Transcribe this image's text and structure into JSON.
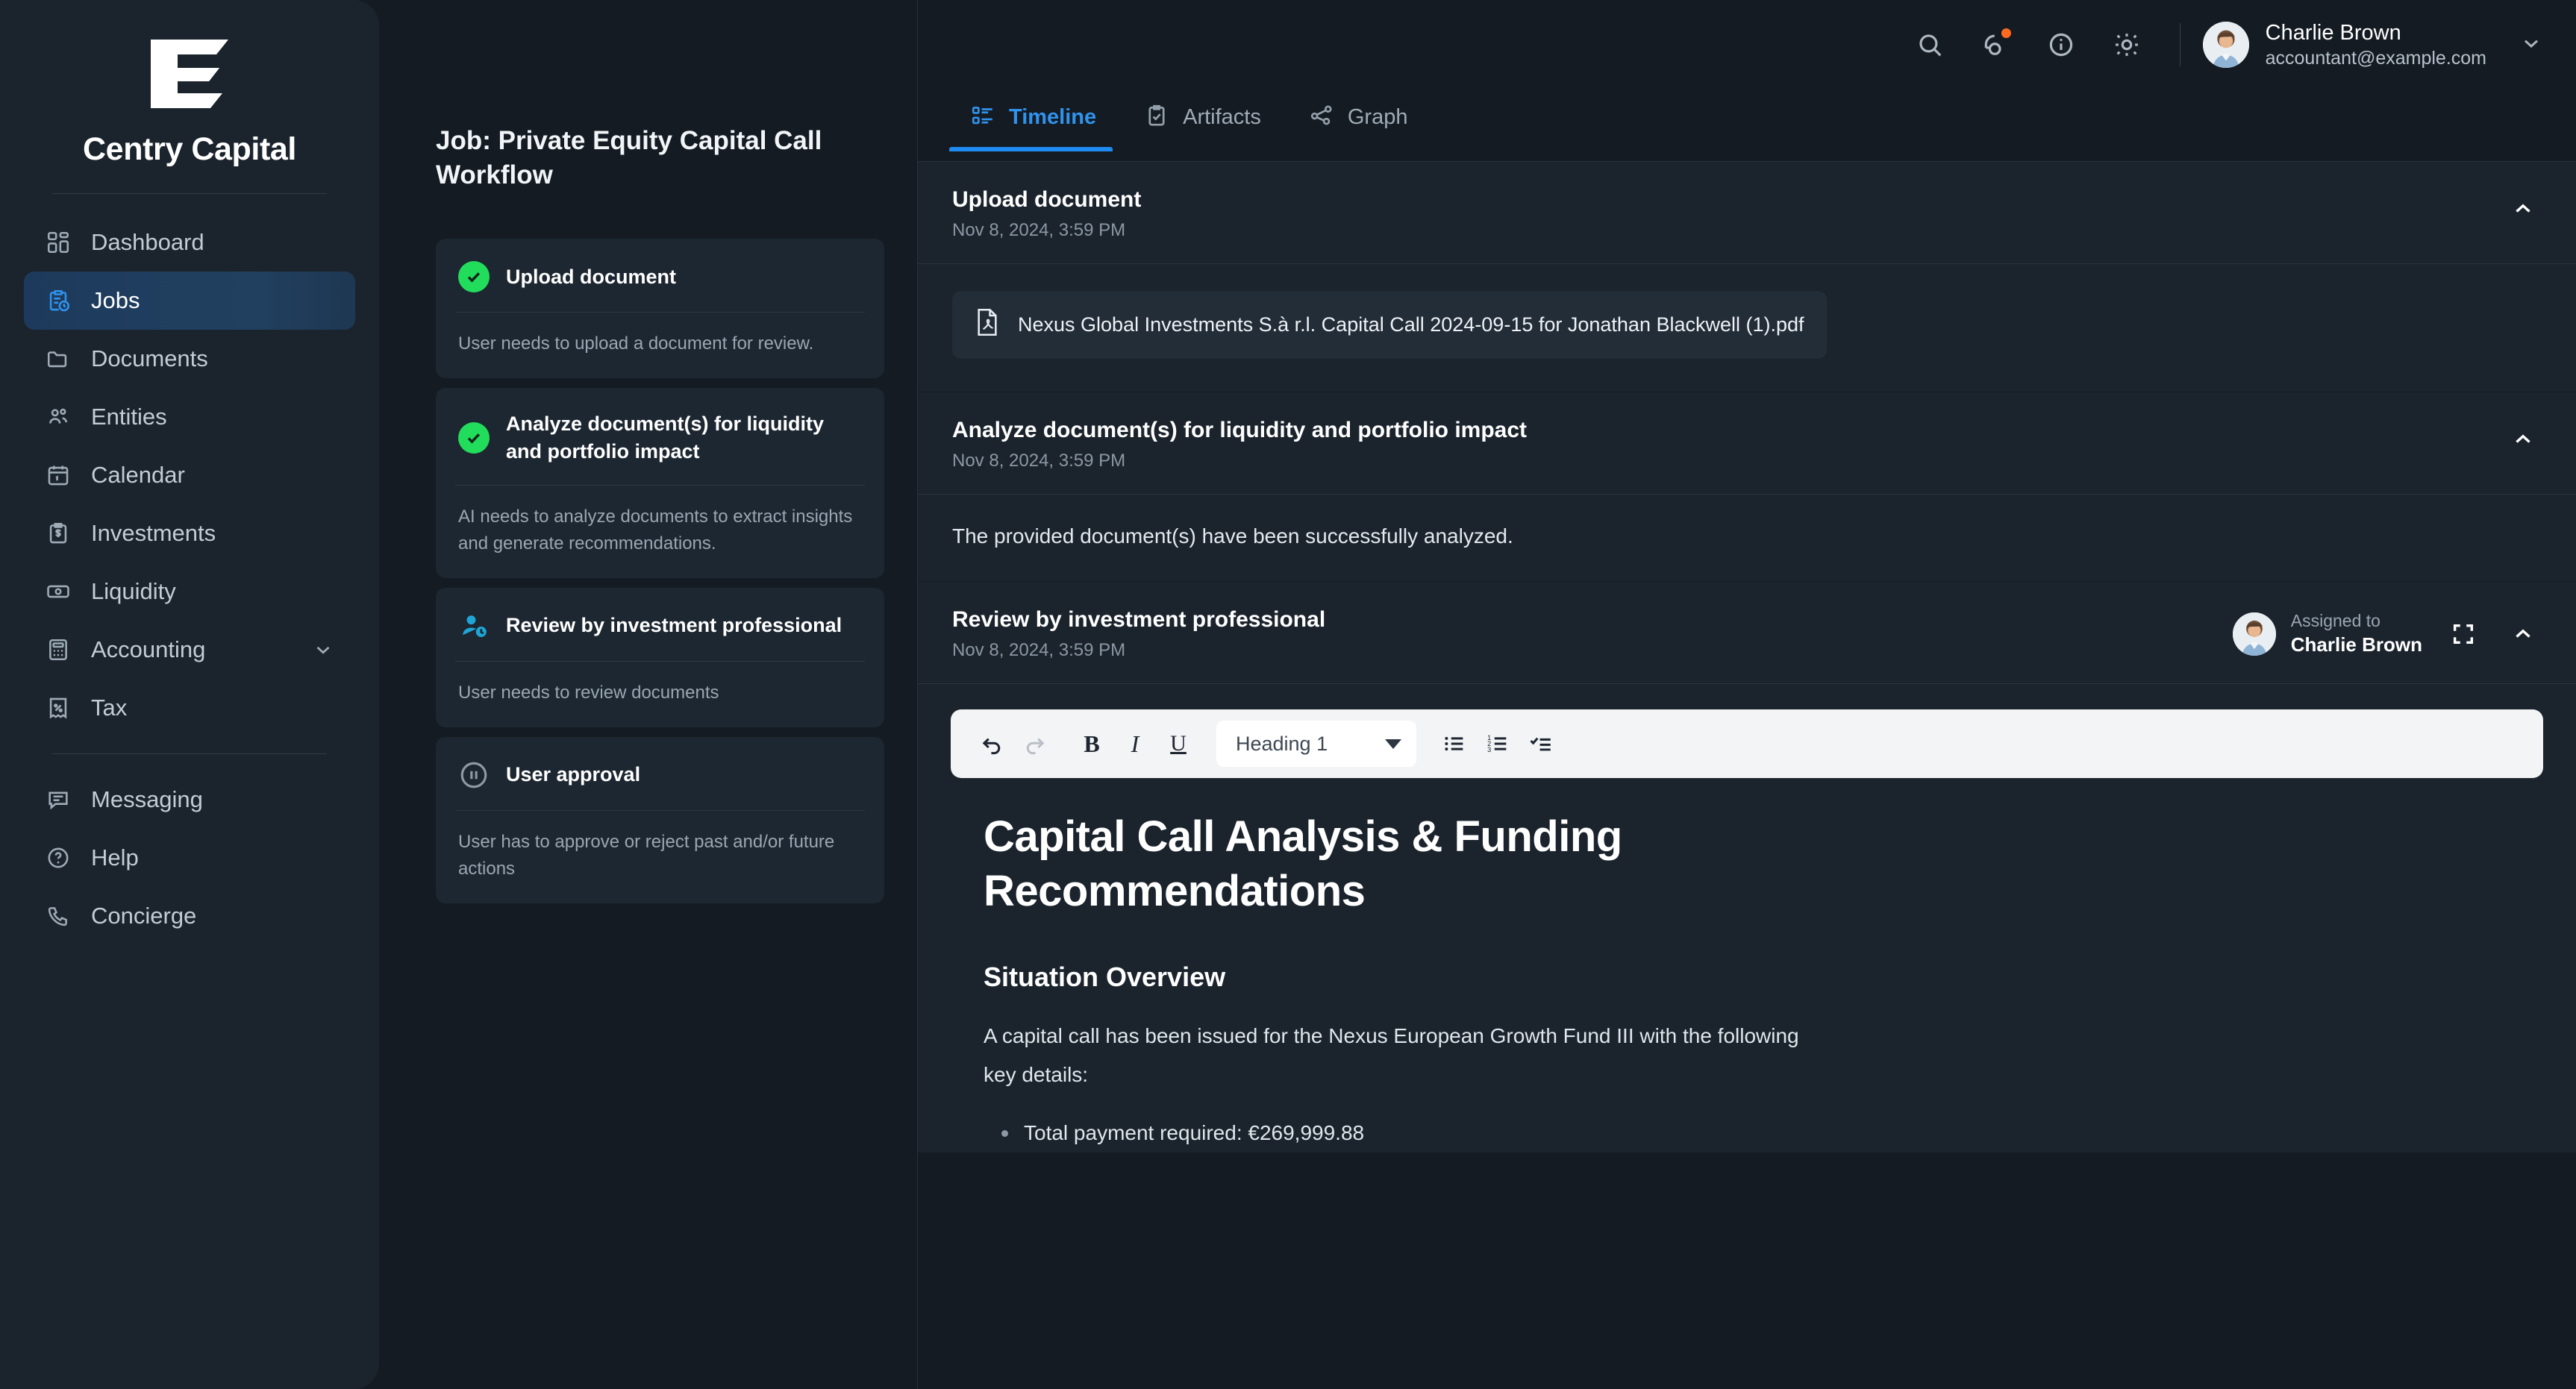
{
  "brand": {
    "name": "Centry Capital",
    "logo_icon": "centry-logo"
  },
  "sidebar": {
    "items": [
      {
        "label": "Dashboard",
        "icon": "dashboard-icon",
        "active": false
      },
      {
        "label": "Jobs",
        "icon": "jobs-clipboard-clock-icon",
        "active": true
      },
      {
        "label": "Documents",
        "icon": "folder-icon",
        "active": false
      },
      {
        "label": "Entities",
        "icon": "users-icon",
        "active": false
      },
      {
        "label": "Calendar",
        "icon": "calendar-icon",
        "active": false
      },
      {
        "label": "Investments",
        "icon": "clipboard-dollar-icon",
        "active": false
      },
      {
        "label": "Liquidity",
        "icon": "banknote-icon",
        "active": false
      },
      {
        "label": "Accounting",
        "icon": "calculator-icon",
        "active": false,
        "expandable": true
      },
      {
        "label": "Tax",
        "icon": "receipt-percent-icon",
        "active": false
      }
    ],
    "footer_items": [
      {
        "label": "Messaging",
        "icon": "chat-icon"
      },
      {
        "label": "Help",
        "icon": "question-circle-icon"
      },
      {
        "label": "Concierge",
        "icon": "phone-icon"
      }
    ]
  },
  "topbar": {
    "icons": [
      {
        "name": "search-icon"
      },
      {
        "name": "notifications-icon",
        "badge": true
      },
      {
        "name": "info-icon"
      },
      {
        "name": "theme-sun-icon"
      }
    ],
    "user": {
      "name": "Charlie Brown",
      "email": "accountant@example.com"
    },
    "caret_icon": "chevron-down-icon"
  },
  "job": {
    "title": "Job: Private Equity Capital Call Workflow",
    "steps": [
      {
        "name": "Upload document",
        "description": "User needs to upload a document for review.",
        "status": "done",
        "status_icon": "check-circle-icon"
      },
      {
        "name": "Analyze document(s) for liquidity and portfolio impact",
        "description": "AI needs to analyze documents to extract insights and generate recommendations.",
        "status": "done",
        "status_icon": "check-circle-icon"
      },
      {
        "name": "Review by investment professional",
        "description": "User needs to review documents",
        "status": "active",
        "status_icon": "user-clock-icon"
      },
      {
        "name": "User approval",
        "description": "User has to approve or reject past and/or future actions",
        "status": "pending",
        "status_icon": "pause-circle-icon"
      }
    ]
  },
  "tabs": [
    {
      "label": "Timeline",
      "icon": "list-icon",
      "active": true
    },
    {
      "label": "Artifacts",
      "icon": "clipboard-check-icon",
      "active": false
    },
    {
      "label": "Graph",
      "icon": "share-nodes-icon",
      "active": false
    }
  ],
  "timeline": [
    {
      "title": "Upload document",
      "timestamp": "Nov 8, 2024, 3:59 PM",
      "collapse_icon": "chevron-up-icon",
      "file": {
        "name": "Nexus Global Investments S.à r.l. Capital Call 2024-09-15 for Jonathan Blackwell (1).pdf",
        "icon": "pdf-file-icon"
      }
    },
    {
      "title": "Analyze document(s) for liquidity and portfolio impact",
      "timestamp": "Nov 8, 2024, 3:59 PM",
      "collapse_icon": "chevron-up-icon",
      "body_text": "The provided document(s) have been successfully analyzed."
    },
    {
      "title": "Review by investment professional",
      "timestamp": "Nov 8, 2024, 3:59 PM",
      "assigned_label": "Assigned to",
      "assigned_name": "Charlie Brown",
      "expand_icon": "fullscreen-icon",
      "collapse_icon": "chevron-up-icon"
    }
  ],
  "editor": {
    "toolbar": {
      "undo_icon": "undo-icon",
      "redo_icon": "redo-icon",
      "bold_label": "B",
      "italic_label": "I",
      "underline_label": "U",
      "heading_value": "Heading 1",
      "heading_caret_icon": "caret-down-icon",
      "bullet_list_icon": "bullet-list-icon",
      "numbered_list_icon": "numbered-list-icon",
      "checklist_icon": "checklist-icon"
    },
    "document": {
      "h1": "Capital Call Analysis & Funding Recommendations",
      "h2": "Situation Overview",
      "paragraph": "A capital call has been issued for the Nexus European Growth Fund III with the following key details:",
      "bullets": [
        "Total payment required: €269,999.88"
      ]
    }
  },
  "colors": {
    "accent_blue": "#2f93ee",
    "success_green": "#22dd5c",
    "active_cyan": "#1ea5d6",
    "badge_orange": "#ff6a1f",
    "sidebar_bg": "#1b242d",
    "page_bg": "#141b22",
    "card_bg": "#1d2731"
  }
}
